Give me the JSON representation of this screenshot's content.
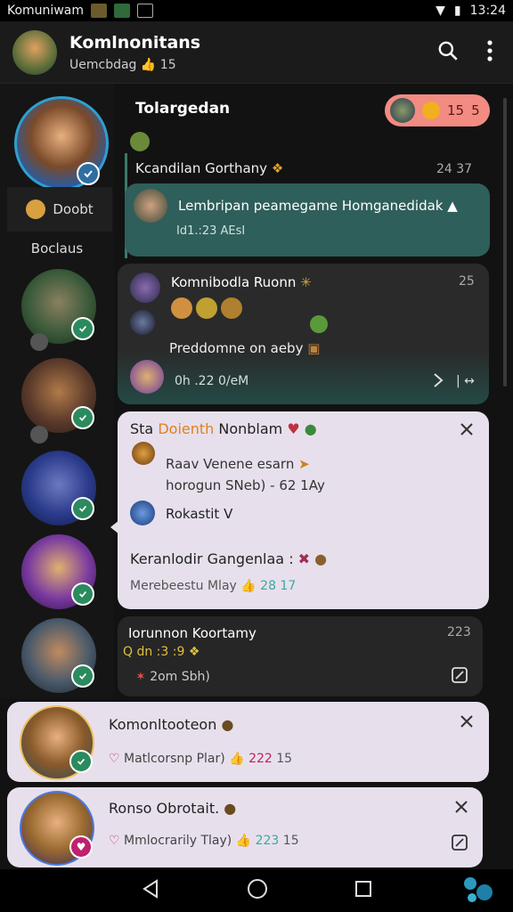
{
  "status": {
    "app_name": "Komuniwam",
    "time": "13:24"
  },
  "header": {
    "title": "Komlnonitans",
    "subtitle": "Uemcbdag",
    "subtitle_count": "15"
  },
  "sidebar": {
    "profile_label": "Doobt",
    "section_label": "Boclaus"
  },
  "feed": {
    "title": "Tolargedan",
    "pill": {
      "count": "15",
      "extra": "5"
    },
    "message1": {
      "sender": "Kcandilan Gorthany",
      "time": "24 37",
      "text": "Lembripan peamegame Homganedidak",
      "meta": "Id1.:23 AEsI"
    },
    "card2": {
      "title": "Komnibodla Ruonn",
      "count": "25",
      "line": "Preddomne on aeby",
      "time": "0h .22 0/eM"
    },
    "card3": {
      "title_a": "Sta",
      "title_b": "Doienth",
      "title_c": "Nonblam",
      "line1": "Raav Venene esarn",
      "line2": "horogun SNeb) -",
      "line2_num": "62 1Ay",
      "user": "Rokastit",
      "user_mark": "V",
      "line3": "Keranlodir Gangenlaa :",
      "foot": "Merebeestu Mlay",
      "foot_num": "28 17"
    },
    "card4": {
      "title": "Iorunnon Koortamy",
      "count": "223",
      "line1": "Q dn :3 :9",
      "line2": "2om Sbh)"
    },
    "card5": {
      "title": "Komonltooteon",
      "foot": "Matlcorsnp Plar)",
      "foot_num": "222",
      "foot_num2": "15"
    },
    "card6": {
      "title": "Ronso Obrotait.",
      "foot": "Mmlocrarily Tlay)",
      "foot_num": "223",
      "foot_num2": "15"
    }
  },
  "colors": {
    "accent_teal": "#2f5f5a",
    "badge_green": "#2b8a5e",
    "pill_red": "#f28b82",
    "card_light": "#e7e0ec"
  },
  "icons": [
    "search-icon",
    "more-vert-icon",
    "check-icon",
    "close-icon",
    "edit-icon",
    "back-icon",
    "home-icon",
    "recents-icon"
  ]
}
